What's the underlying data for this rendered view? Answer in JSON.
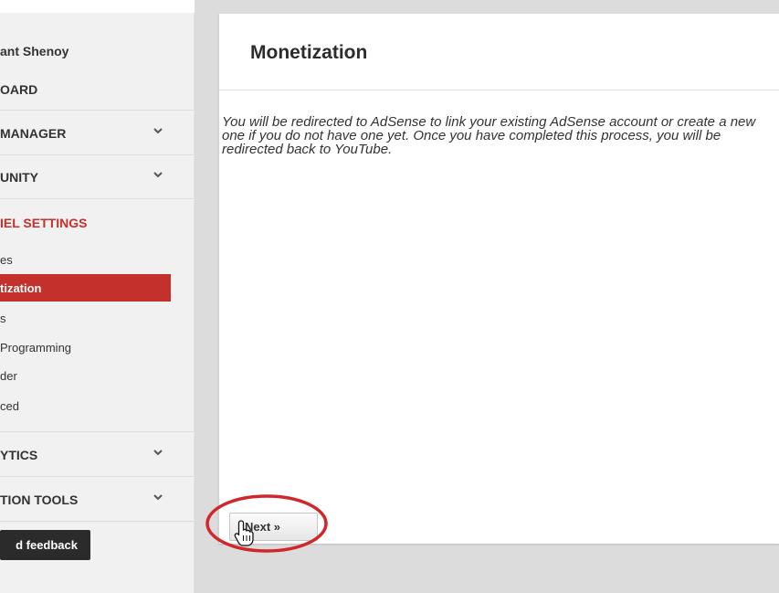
{
  "sidebar": {
    "user_name": "ant Shenoy",
    "dashboard_label": "OARD",
    "sections": [
      {
        "label": "MANAGER"
      },
      {
        "label": "UNITY"
      }
    ],
    "channel_settings_label": "IEL SETTINGS",
    "sub_items": [
      {
        "label": "es"
      },
      {
        "label": "tization"
      },
      {
        "label": "s"
      },
      {
        "label": "Programming"
      },
      {
        "label": "der"
      },
      {
        "label": "ced"
      }
    ],
    "bottom_sections": [
      {
        "label": "YTICS"
      },
      {
        "label": "TION TOOLS"
      }
    ],
    "feedback_label": "d feedback"
  },
  "main": {
    "title": "Monetization",
    "description": "You will be redirected to AdSense to link your existing AdSense account or create a new one if you do not have one yet. Once you have completed this process, you will be redirected back to YouTube.",
    "next_label": "Next »"
  },
  "colors": {
    "accent": "#c4302b",
    "highlight_circle": "#d0272b",
    "button_dark": "#2b2b2b"
  },
  "icons": {
    "chevron": "chevron-down-icon",
    "cursor": "hand-pointer-icon"
  }
}
